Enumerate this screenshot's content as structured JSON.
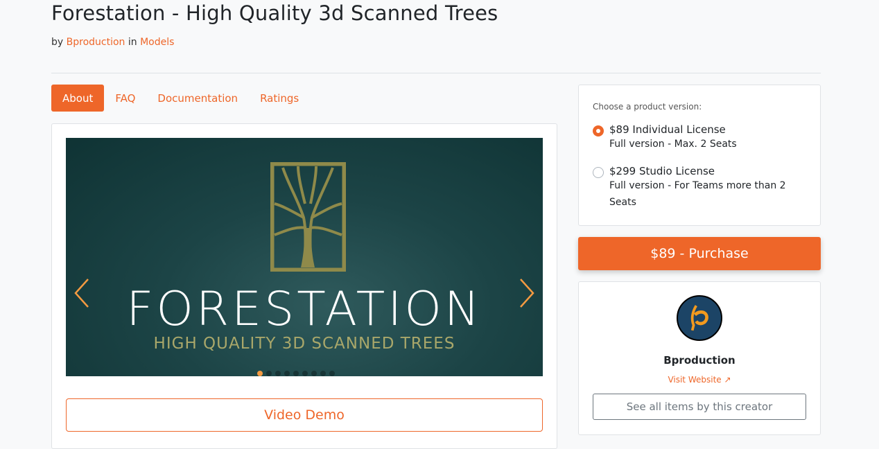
{
  "header": {
    "title": "Forestation - High Quality 3d Scanned Trees",
    "by": "by",
    "author": "Bproduction",
    "in": "in",
    "category": "Models"
  },
  "tabs": [
    {
      "label": "About"
    },
    {
      "label": "FAQ"
    },
    {
      "label": "Documentation"
    },
    {
      "label": "Ratings"
    }
  ],
  "carousel": {
    "banner_title": "FORESTATION",
    "banner_subtitle": "HIGH QUALITY 3D SCANNED TREES",
    "slide_count": 9,
    "active_slide": 1
  },
  "video_demo": "Video Demo",
  "versions": {
    "prompt": "Choose a product version:",
    "options": [
      {
        "title": "$89 Individual License",
        "desc": "Full version - Max. 2 Seats",
        "selected": true
      },
      {
        "title": "$299 Studio License",
        "desc": "Full version - For Teams more than 2 Seats",
        "selected": false
      }
    ]
  },
  "purchase_label": "$89 - Purchase",
  "creator": {
    "name": "Bproduction",
    "visit": "Visit Website",
    "see_all": "See all items by this creator"
  },
  "colors": {
    "accent": "#ee6629",
    "banner": "#1c4446",
    "gold": "#a9a76a"
  }
}
